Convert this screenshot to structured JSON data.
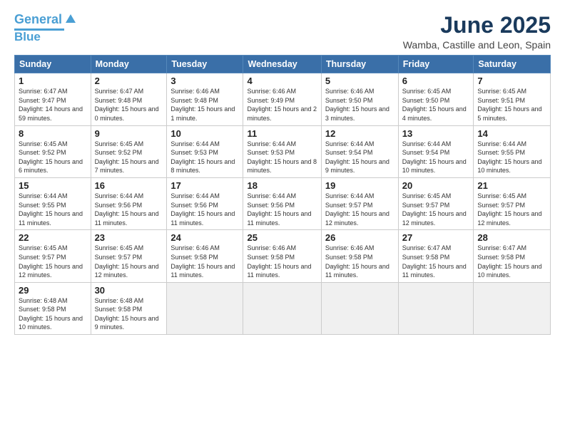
{
  "logo": {
    "line1": "General",
    "line2": "Blue"
  },
  "title": "June 2025",
  "subtitle": "Wamba, Castille and Leon, Spain",
  "headers": [
    "Sunday",
    "Monday",
    "Tuesday",
    "Wednesday",
    "Thursday",
    "Friday",
    "Saturday"
  ],
  "weeks": [
    [
      {
        "day": "1",
        "info": "Sunrise: 6:47 AM\nSunset: 9:47 PM\nDaylight: 14 hours and 59 minutes."
      },
      {
        "day": "2",
        "info": "Sunrise: 6:47 AM\nSunset: 9:48 PM\nDaylight: 15 hours and 0 minutes."
      },
      {
        "day": "3",
        "info": "Sunrise: 6:46 AM\nSunset: 9:48 PM\nDaylight: 15 hours and 1 minute."
      },
      {
        "day": "4",
        "info": "Sunrise: 6:46 AM\nSunset: 9:49 PM\nDaylight: 15 hours and 2 minutes."
      },
      {
        "day": "5",
        "info": "Sunrise: 6:46 AM\nSunset: 9:50 PM\nDaylight: 15 hours and 3 minutes."
      },
      {
        "day": "6",
        "info": "Sunrise: 6:45 AM\nSunset: 9:50 PM\nDaylight: 15 hours and 4 minutes."
      },
      {
        "day": "7",
        "info": "Sunrise: 6:45 AM\nSunset: 9:51 PM\nDaylight: 15 hours and 5 minutes."
      }
    ],
    [
      {
        "day": "8",
        "info": "Sunrise: 6:45 AM\nSunset: 9:52 PM\nDaylight: 15 hours and 6 minutes."
      },
      {
        "day": "9",
        "info": "Sunrise: 6:45 AM\nSunset: 9:52 PM\nDaylight: 15 hours and 7 minutes."
      },
      {
        "day": "10",
        "info": "Sunrise: 6:44 AM\nSunset: 9:53 PM\nDaylight: 15 hours and 8 minutes."
      },
      {
        "day": "11",
        "info": "Sunrise: 6:44 AM\nSunset: 9:53 PM\nDaylight: 15 hours and 8 minutes."
      },
      {
        "day": "12",
        "info": "Sunrise: 6:44 AM\nSunset: 9:54 PM\nDaylight: 15 hours and 9 minutes."
      },
      {
        "day": "13",
        "info": "Sunrise: 6:44 AM\nSunset: 9:54 PM\nDaylight: 15 hours and 10 minutes."
      },
      {
        "day": "14",
        "info": "Sunrise: 6:44 AM\nSunset: 9:55 PM\nDaylight: 15 hours and 10 minutes."
      }
    ],
    [
      {
        "day": "15",
        "info": "Sunrise: 6:44 AM\nSunset: 9:55 PM\nDaylight: 15 hours and 11 minutes."
      },
      {
        "day": "16",
        "info": "Sunrise: 6:44 AM\nSunset: 9:56 PM\nDaylight: 15 hours and 11 minutes."
      },
      {
        "day": "17",
        "info": "Sunrise: 6:44 AM\nSunset: 9:56 PM\nDaylight: 15 hours and 11 minutes."
      },
      {
        "day": "18",
        "info": "Sunrise: 6:44 AM\nSunset: 9:56 PM\nDaylight: 15 hours and 11 minutes."
      },
      {
        "day": "19",
        "info": "Sunrise: 6:44 AM\nSunset: 9:57 PM\nDaylight: 15 hours and 12 minutes."
      },
      {
        "day": "20",
        "info": "Sunrise: 6:45 AM\nSunset: 9:57 PM\nDaylight: 15 hours and 12 minutes."
      },
      {
        "day": "21",
        "info": "Sunrise: 6:45 AM\nSunset: 9:57 PM\nDaylight: 15 hours and 12 minutes."
      }
    ],
    [
      {
        "day": "22",
        "info": "Sunrise: 6:45 AM\nSunset: 9:57 PM\nDaylight: 15 hours and 12 minutes."
      },
      {
        "day": "23",
        "info": "Sunrise: 6:45 AM\nSunset: 9:57 PM\nDaylight: 15 hours and 12 minutes."
      },
      {
        "day": "24",
        "info": "Sunrise: 6:46 AM\nSunset: 9:58 PM\nDaylight: 15 hours and 11 minutes."
      },
      {
        "day": "25",
        "info": "Sunrise: 6:46 AM\nSunset: 9:58 PM\nDaylight: 15 hours and 11 minutes."
      },
      {
        "day": "26",
        "info": "Sunrise: 6:46 AM\nSunset: 9:58 PM\nDaylight: 15 hours and 11 minutes."
      },
      {
        "day": "27",
        "info": "Sunrise: 6:47 AM\nSunset: 9:58 PM\nDaylight: 15 hours and 11 minutes."
      },
      {
        "day": "28",
        "info": "Sunrise: 6:47 AM\nSunset: 9:58 PM\nDaylight: 15 hours and 10 minutes."
      }
    ],
    [
      {
        "day": "29",
        "info": "Sunrise: 6:48 AM\nSunset: 9:58 PM\nDaylight: 15 hours and 10 minutes."
      },
      {
        "day": "30",
        "info": "Sunrise: 6:48 AM\nSunset: 9:58 PM\nDaylight: 15 hours and 9 minutes."
      },
      {
        "day": "",
        "info": ""
      },
      {
        "day": "",
        "info": ""
      },
      {
        "day": "",
        "info": ""
      },
      {
        "day": "",
        "info": ""
      },
      {
        "day": "",
        "info": ""
      }
    ]
  ]
}
